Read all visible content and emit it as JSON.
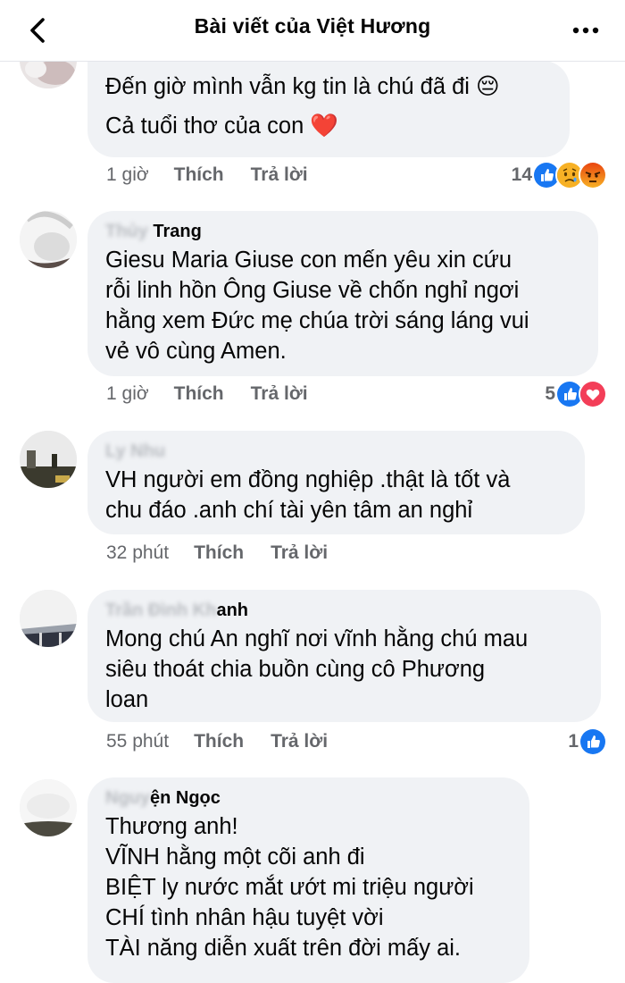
{
  "header": {
    "title": "Bài viết của Việt Hương"
  },
  "comments": [
    {
      "author_visible": "",
      "lines": [
        "Đến giờ mình vẫn kg tin là chú đã đi 😔",
        "Cả tuổi thơ của con ❤️"
      ],
      "time": "1 giờ",
      "like": "Thích",
      "reply": "Trả lời",
      "reaction_count": "14",
      "reactions": [
        "like",
        "sad",
        "angry"
      ]
    },
    {
      "author_blur": "Thủy ",
      "author_visible": "Trang",
      "lines": [
        "Giesu Maria Giuse con mến yêu xin cứu",
        "rỗi linh hồn Ông Giuse về chốn nghỉ ngơi",
        "hằng xem Đức mẹ chúa trời sáng láng vui",
        "vẻ vô cùng Amen."
      ],
      "time": "1 giờ",
      "like": "Thích",
      "reply": "Trả lời",
      "reaction_count": "5",
      "reactions": [
        "like",
        "love"
      ]
    },
    {
      "author_blur": "Ly Nhu",
      "author_visible": "",
      "lines": [
        "VH người em đồng nghiệp .thật là tốt và",
        "chu đáo .anh chí tài yên tâm an nghỉ"
      ],
      "time": "32 phút",
      "like": "Thích",
      "reply": "Trả lời"
    },
    {
      "author_blur": "Trần Đình Kh",
      "author_visible": "anh",
      "lines": [
        "Mong chú An nghĩ nơi vĩnh hằng chú mau",
        "siêu thoát chia buồn cùng cô Phương",
        "loan"
      ],
      "time": "55 phút",
      "like": "Thích",
      "reply": "Trả lời",
      "reaction_count": "1",
      "reactions": [
        "like"
      ]
    },
    {
      "author_blur": "Nguy",
      "author_visible": "ện Ngọc",
      "lines": [
        "Thương anh!",
        "VĨNH hằng một cõi anh đi",
        "BIỆT ly nước mắt ướt mi triệu người",
        "CHÍ tình nhân hậu tuyệt vời",
        "TÀI năng diễn xuất trên đời mấy ai."
      ]
    }
  ],
  "colors": {
    "like_blue": "#1877f2",
    "love_red": "#f33e58",
    "sad_yellow": "#f7b125",
    "angry_orange": "#e9710f",
    "bubble_bg": "#f0f2f5",
    "meta_gray": "#65676b"
  }
}
